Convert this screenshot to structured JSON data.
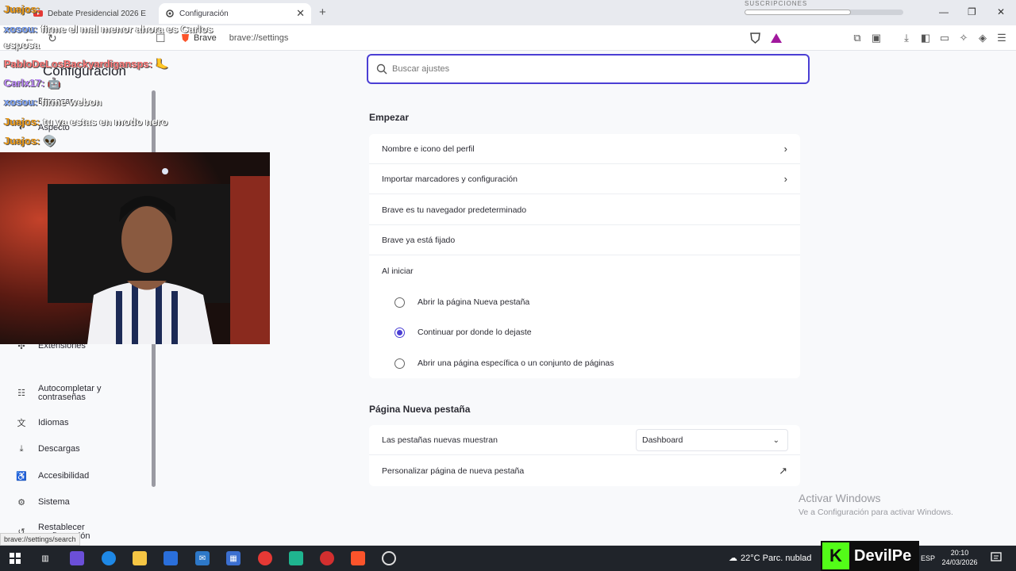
{
  "browser": {
    "tabs": [
      {
        "title": "Debate Presidencial 2026 E"
      },
      {
        "title": "Configuración"
      }
    ],
    "address": {
      "site": "Brave",
      "url": "brave://settings"
    },
    "subs_label": "SUSCRIPCIONES",
    "subs_progress": 0.67
  },
  "sidebar": {
    "title": "Configuración",
    "items": [
      {
        "label": "Empezar"
      },
      {
        "label": "Aspecto"
      },
      {
        "label": "Extensiones"
      },
      {
        "label": "Autocompletar y contraseñas"
      },
      {
        "label": "Idiomas"
      },
      {
        "label": "Descargas"
      },
      {
        "label": "Accesibilidad"
      },
      {
        "label": "Sistema"
      },
      {
        "label": "Restablecer configuración"
      }
    ],
    "status_url": "brave://settings/search"
  },
  "search": {
    "placeholder": "Buscar ajustes"
  },
  "empezar": {
    "title": "Empezar",
    "rows": [
      {
        "label": "Nombre e icono del perfil"
      },
      {
        "label": "Importar marcadores y configuración"
      },
      {
        "label": "Brave es tu navegador predeterminado"
      },
      {
        "label": "Brave ya está fijado"
      },
      {
        "label": "Al iniciar"
      }
    ],
    "startup_options": [
      {
        "label": "Abrir la página Nueva pestaña",
        "selected": false
      },
      {
        "label": "Continuar por donde lo dejaste",
        "selected": true
      },
      {
        "label": "Abrir una página específica o un conjunto de páginas",
        "selected": false
      }
    ]
  },
  "new_tab": {
    "title": "Página Nueva pestaña",
    "shows_label": "Las pestañas nuevas muestran",
    "shows_value": "Dashboard",
    "customize_label": "Personalizar página de nueva pestaña"
  },
  "watermark": {
    "title": "Activar Windows",
    "subtitle": "Ve a Configuración para activar Windows."
  },
  "chat": [
    {
      "user": "Juajos:",
      "text": ""
    },
    {
      "user": "xosou:",
      "text": "firme el mal menor ahora es Carlos"
    },
    {
      "user": "",
      "text": "esposa"
    },
    {
      "user": "PabloDeLosBackyardigansps:",
      "text": ""
    },
    {
      "user": "Carlx17:",
      "text": ""
    },
    {
      "user": "xosou:",
      "text": "firme webon"
    },
    {
      "user": "Juajos:",
      "text": "tu ya estas en modo nero"
    },
    {
      "user": "Juajos:",
      "text": ""
    }
  ],
  "taskbar": {
    "weather": "22°C  Parc. nublad",
    "streamer": "DevilPe",
    "lang": "ESP",
    "time": "20:10",
    "date": "24/03/2026"
  },
  "colors": {
    "accent": "#4b3fd4",
    "kick_green": "#53fc18"
  }
}
